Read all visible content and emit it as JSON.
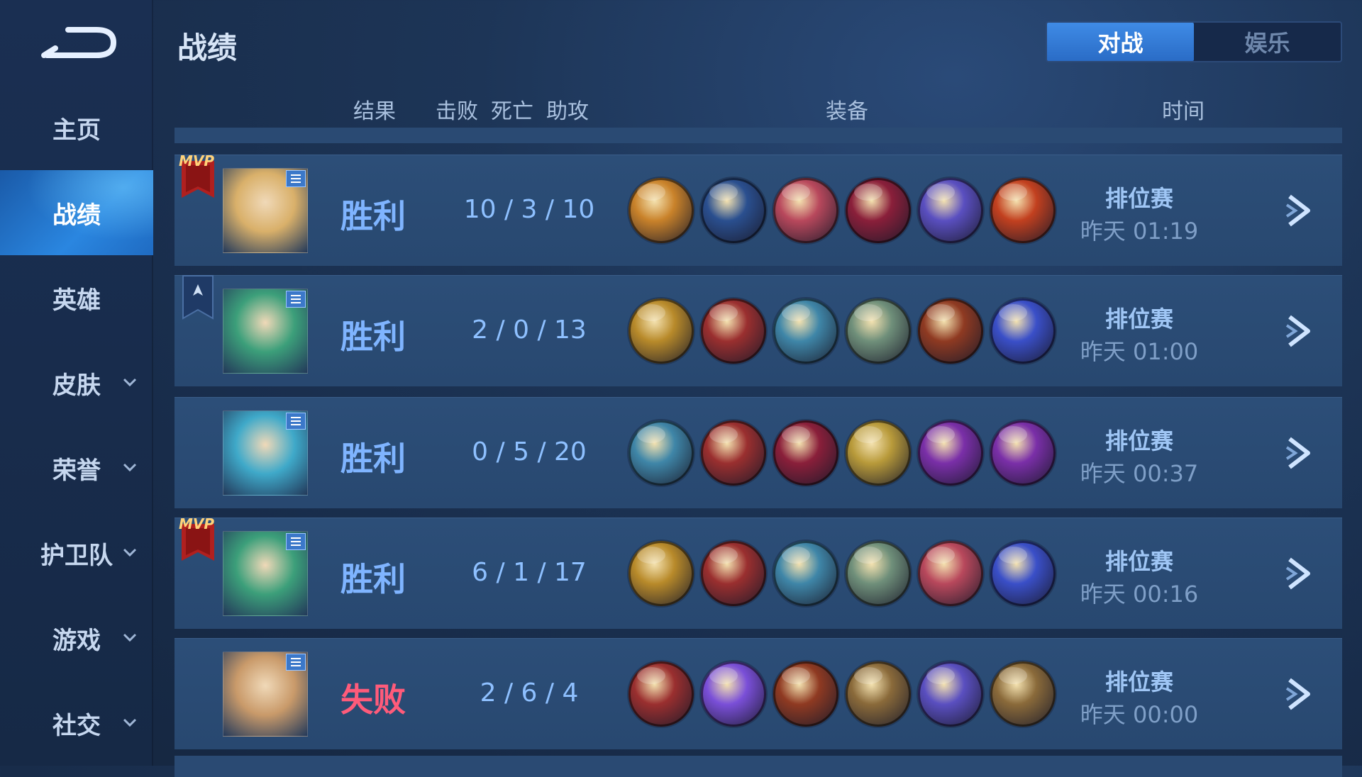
{
  "sidebar": {
    "items": [
      {
        "label": "主页",
        "dropdown": false,
        "active": false
      },
      {
        "label": "战绩",
        "dropdown": false,
        "active": true
      },
      {
        "label": "英雄",
        "dropdown": false,
        "active": false
      },
      {
        "label": "皮肤",
        "dropdown": true,
        "active": false
      },
      {
        "label": "荣誉",
        "dropdown": true,
        "active": false
      },
      {
        "label": "护卫队",
        "dropdown": true,
        "active": false
      },
      {
        "label": "游戏",
        "dropdown": true,
        "active": false
      },
      {
        "label": "社交",
        "dropdown": true,
        "active": false
      }
    ]
  },
  "header": {
    "title": "战绩",
    "tabs": [
      {
        "label": "对战",
        "active": true
      },
      {
        "label": "娱乐",
        "active": false
      }
    ]
  },
  "columns": {
    "result": "结果",
    "kills": "击败",
    "deaths": "死亡",
    "assists": "助攻",
    "equipment": "装备",
    "time": "时间"
  },
  "matches": [
    {
      "badge": "mvp",
      "badge_text": "MVP",
      "hero_color": "#d9b06a",
      "result": "胜利",
      "win": true,
      "kda": "10 / 3 / 10",
      "mode": "排位赛",
      "time": "昨天 01:19",
      "items": [
        "#c9822a",
        "#2a4f8f",
        "#b8485c",
        "#8a1f3a",
        "#5a4fc0",
        "#c2401f"
      ]
    },
    {
      "badge": "wing",
      "badge_text": "",
      "hero_color": "#3c9f7a",
      "result": "胜利",
      "win": true,
      "kda": "2 / 0 / 13",
      "mode": "排位赛",
      "time": "昨天 01:00",
      "items": [
        "#b88a2a",
        "#9a2f2f",
        "#3f86a8",
        "#6f8f7a",
        "#8f3a22",
        "#3a4fc8"
      ]
    },
    {
      "badge": "",
      "badge_text": "",
      "hero_color": "#3fa9c9",
      "result": "胜利",
      "win": true,
      "kda": "0 / 5 / 20",
      "mode": "排位赛",
      "time": "昨天 00:37",
      "items": [
        "#3f86a8",
        "#9a2f2f",
        "#8a1f3a",
        "#b89a3a",
        "#7a2fa8",
        "#7a2fa8"
      ]
    },
    {
      "badge": "mvp",
      "badge_text": "MVP",
      "hero_color": "#3c9f7a",
      "result": "胜利",
      "win": true,
      "kda": "6 / 1 / 17",
      "mode": "排位赛",
      "time": "昨天 00:16",
      "items": [
        "#b88a2a",
        "#9a2f2f",
        "#3f86a8",
        "#6f8f7a",
        "#b8485c",
        "#3a4fc8"
      ]
    },
    {
      "badge": "",
      "badge_text": "",
      "hero_color": "#c99a6a",
      "result": "失败",
      "win": false,
      "kda": "2 / 6 / 4",
      "mode": "排位赛",
      "time": "昨天 00:00",
      "items": [
        "#9a2f2f",
        "#7a4fd8",
        "#8f3a22",
        "#8a6a3a",
        "#5a4fc0",
        "#8a6a3a"
      ]
    }
  ]
}
